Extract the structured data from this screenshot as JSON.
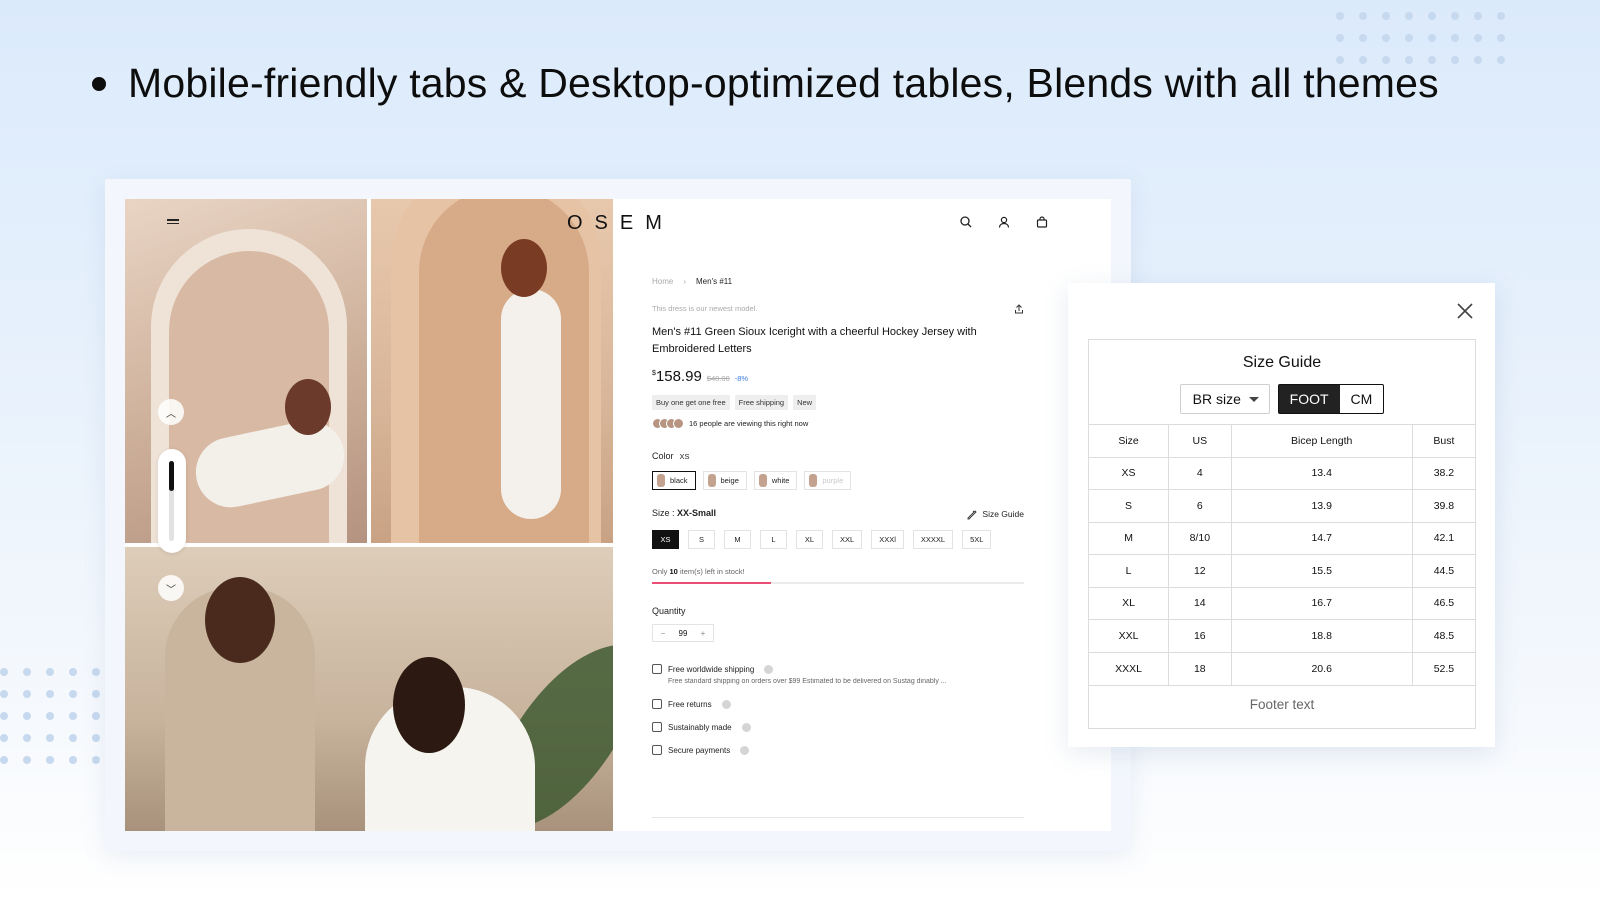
{
  "headline": "Mobile-friendly tabs & Desktop-optimized tables, Blends with all themes",
  "store": {
    "logo": "OSEM",
    "breadcrumb": {
      "home": "Home",
      "current": "Men's #11"
    },
    "teaser": "This dress is our newest model.",
    "title": "Men's #11 Green Sioux Iceright with a cheerful Hockey Jersey with Embroidered Letters",
    "price": {
      "currency": "$",
      "amount": "158.99",
      "old": "$48.00",
      "discount": "-8%"
    },
    "tags": [
      "Buy one get one free",
      "Free shipping",
      "New"
    ],
    "viewers": "16 people are viewing this right now",
    "color": {
      "label": "Color",
      "selected": "XS",
      "options": [
        "black",
        "beige",
        "white",
        "purple"
      ]
    },
    "size": {
      "label": "Size :",
      "selected": "XX-Small",
      "guide_link": "Size Guide",
      "options": [
        "XS",
        "S",
        "M",
        "L",
        "XL",
        "XXL",
        "XXXl",
        "XXXXL",
        "5XL"
      ]
    },
    "stock": {
      "prefix": "Only",
      "count": "10",
      "suffix": "item(s) left in stock!",
      "level": 0.32
    },
    "quantity": {
      "label": "Quantity",
      "minus": "−",
      "value": "99",
      "plus": "+"
    },
    "perks": {
      "shipping": "Free worldwide shipping",
      "shipping_sub": "Free standard shipping on orders over $99 Estimated to be delivered on Sustag dinably ...",
      "returns": "Free returns",
      "sustainable": "Sustainably made",
      "payments": "Secure payments"
    }
  },
  "size_guide": {
    "title": "Size Guide",
    "region_select": "BR size",
    "units": [
      "FOOT",
      "CM"
    ],
    "columns": [
      "Size",
      "US",
      "Bicep Length",
      "Bust"
    ],
    "rows": [
      [
        "XS",
        "4",
        "13.4",
        "38.2"
      ],
      [
        "S",
        "6",
        "13.9",
        "39.8"
      ],
      [
        "M",
        "8/10",
        "14.7",
        "42.1"
      ],
      [
        "L",
        "12",
        "15.5",
        "44.5"
      ],
      [
        "XL",
        "14",
        "16.7",
        "46.5"
      ],
      [
        "XXL",
        "16",
        "18.8",
        "48.5"
      ],
      [
        "XXXL",
        "18",
        "20.6",
        "52.5"
      ]
    ],
    "footer": "Footer text"
  },
  "colors": {
    "accent_pink": "#ec4d77",
    "discount_blue": "#3b7de0",
    "toggle_active": "#222222"
  }
}
